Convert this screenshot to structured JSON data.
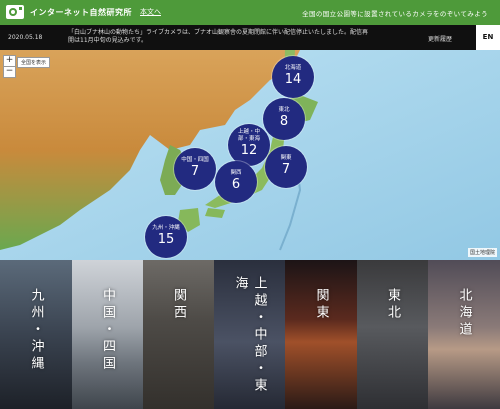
{
  "header": {
    "site_title": "インターネット自然研究所",
    "about": "本文へ",
    "tagline": "全国の国立公園等に設置されているカメラをのぞいてみよう"
  },
  "news": {
    "date": "2020.05.18",
    "text": "「白山ブナ林山の動物たち」ライブカメラは、ブナオ山観察舎の夏期閉館に伴い配信停止いたしました。配信再開は11月中旬の見込みです。",
    "history_link": "更新履歴"
  },
  "lang": "EN",
  "map": {
    "zoom_in": "+",
    "zoom_out": "−",
    "show_all": "全国を表示",
    "credit": "国土地理院"
  },
  "markers": [
    {
      "label": "北海道",
      "count": "14"
    },
    {
      "label": "東北",
      "count": "8"
    },
    {
      "label": "上越・中部・東海",
      "count": "12"
    },
    {
      "label": "関東",
      "count": "7"
    },
    {
      "label": "中国・四国",
      "count": "7"
    },
    {
      "label": "関西",
      "count": "6"
    },
    {
      "label": "九州・沖縄",
      "count": "15"
    }
  ],
  "regions": [
    {
      "label": "九州・沖縄"
    },
    {
      "label": "中国・四国"
    },
    {
      "label": "関西"
    },
    {
      "label": "上越・中部・東海"
    },
    {
      "label": "関東"
    },
    {
      "label": "東北"
    },
    {
      "label": "北海道"
    }
  ],
  "colors": {
    "header_green": "#4e9a3a",
    "marker_blue": "#222a80",
    "sea": "#a9d6ec"
  }
}
